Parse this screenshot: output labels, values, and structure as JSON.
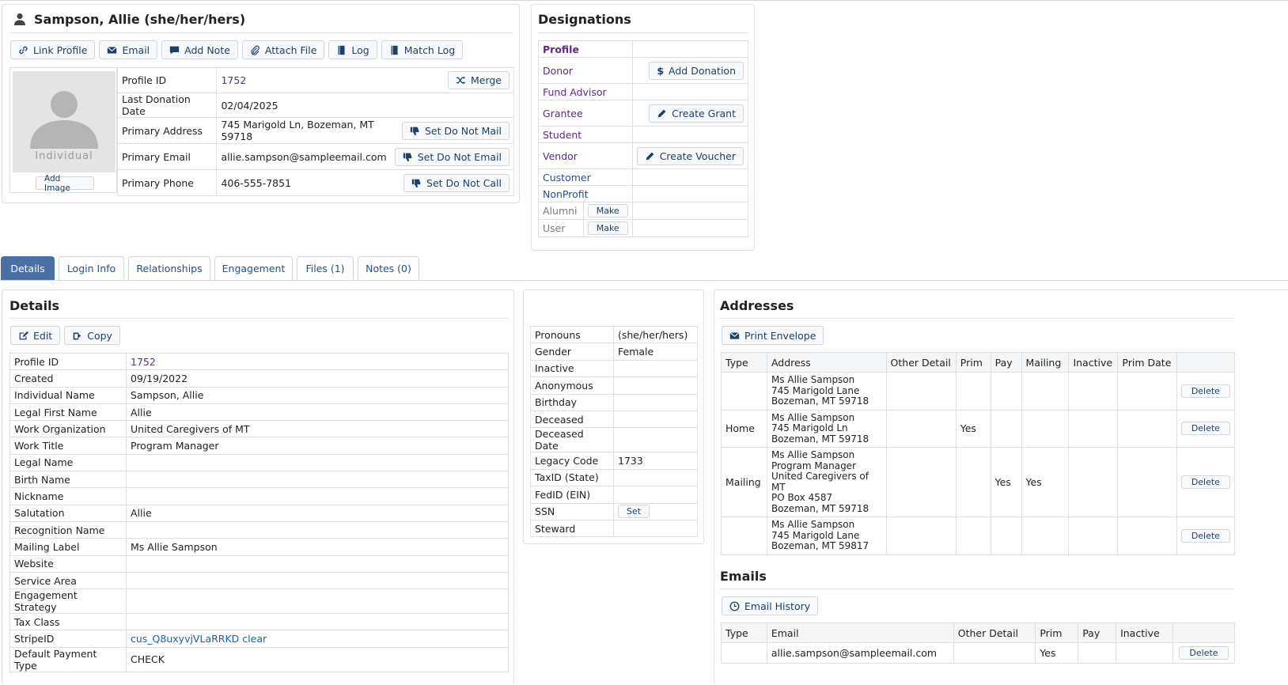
{
  "profile": {
    "title": "Sampson, Allie (she/her/hers)",
    "actions": {
      "link_profile": "Link Profile",
      "email": "Email",
      "add_note": "Add Note",
      "attach_file": "Attach File",
      "log": "Log",
      "match_log": "Match Log"
    },
    "photo_label": "Individual",
    "add_image": "Add Image",
    "fields": {
      "profile_id_label": "Profile ID",
      "profile_id": "1752",
      "merge": "Merge",
      "last_donation_label": "Last Donation Date",
      "last_donation": "02/04/2025",
      "address_label": "Primary Address",
      "address": "745 Marigold Ln, Bozeman, MT 59718",
      "do_not_mail": "Set Do Not Mail",
      "email_label": "Primary Email",
      "email": "allie.sampson@sampleemail.com",
      "do_not_email": "Set Do Not Email",
      "phone_label": "Primary Phone",
      "phone": "406-555-7851",
      "do_not_call": "Set Do Not Call"
    }
  },
  "designations": {
    "title": "Designations",
    "profile": "Profile",
    "donor": "Donor",
    "add_donation": "Add Donation",
    "fund_advisor": "Fund Advisor",
    "grantee": "Grantee",
    "create_grant": "Create Grant",
    "student": "Student",
    "vendor": "Vendor",
    "create_voucher": "Create Voucher",
    "customer": "Customer",
    "nonprofit": "NonProfit",
    "alumni": "Alumni",
    "user": "User",
    "make": "Make"
  },
  "tabs": [
    "Details",
    "Login Info",
    "Relationships",
    "Engagement",
    "Files (1)",
    "Notes (0)"
  ],
  "details": {
    "title": "Details",
    "edit": "Edit",
    "copy": "Copy",
    "rows": [
      {
        "label": "Profile ID",
        "value": "1752"
      },
      {
        "label": "Created",
        "value": "09/19/2022"
      },
      {
        "label": "Individual Name",
        "value": "Sampson, Allie"
      },
      {
        "label": "Legal First Name",
        "value": "Allie"
      },
      {
        "label": "Work Organization",
        "value": "United Caregivers of MT"
      },
      {
        "label": "Work Title",
        "value": "Program Manager"
      },
      {
        "label": "Legal Name",
        "value": ""
      },
      {
        "label": "Birth Name",
        "value": ""
      },
      {
        "label": "Nickname",
        "value": ""
      },
      {
        "label": "Salutation",
        "value": "Allie"
      },
      {
        "label": "Recognition Name",
        "value": ""
      },
      {
        "label": "Mailing Label",
        "value": "Ms Allie Sampson"
      },
      {
        "label": "Website",
        "value": ""
      },
      {
        "label": "Service Area",
        "value": ""
      },
      {
        "label": "Engagement Strategy",
        "value": ""
      },
      {
        "label": "Tax Class",
        "value": ""
      },
      {
        "label": "StripeID",
        "value": "cus_Q8uxyvjVLaRRKD clear"
      },
      {
        "label": "Default Payment Type",
        "value": "CHECK"
      }
    ]
  },
  "personal": {
    "rows": [
      {
        "label": "Pronouns",
        "value": "(she/her/hers)"
      },
      {
        "label": "Gender",
        "value": "Female"
      },
      {
        "label": "Inactive",
        "value": ""
      },
      {
        "label": "Anonymous",
        "value": ""
      },
      {
        "label": "Birthday",
        "value": ""
      },
      {
        "label": "Deceased",
        "value": ""
      },
      {
        "label": "Deceased Date",
        "value": ""
      },
      {
        "label": "Legacy Code",
        "value": "1733"
      },
      {
        "label": "TaxID (State)",
        "value": ""
      },
      {
        "label": "FedID (EIN)",
        "value": ""
      },
      {
        "label": "SSN",
        "value": ""
      },
      {
        "label": "Steward",
        "value": ""
      }
    ],
    "set": "Set"
  },
  "addresses": {
    "title": "Addresses",
    "print_envelope": "Print Envelope",
    "headers": [
      "Type",
      "Address",
      "Other Detail",
      "Prim",
      "Pay",
      "Mailing",
      "Inactive",
      "Prim Date",
      ""
    ],
    "rows": [
      {
        "type": "",
        "lines": [
          "Ms Allie Sampson",
          "745 Marigold Lane",
          "Bozeman, MT 59718"
        ],
        "prim": "",
        "pay": "",
        "mailing": ""
      },
      {
        "type": "Home",
        "lines": [
          "Ms Allie Sampson",
          "745 Marigold Ln",
          "Bozeman, MT 59718"
        ],
        "prim": "Yes",
        "pay": "",
        "mailing": ""
      },
      {
        "type": "Mailing",
        "lines": [
          "Ms Allie Sampson",
          "Program Manager",
          "United Caregivers of MT",
          "PO Box 4587",
          "Bozeman, MT 59718"
        ],
        "prim": "",
        "pay": "Yes",
        "mailing": "Yes"
      },
      {
        "type": "",
        "lines": [
          "Ms Allie Sampson",
          "745 Marigold Lane",
          "Bozeman, MT 59817"
        ],
        "prim": "",
        "pay": "",
        "mailing": ""
      }
    ],
    "delete": "Delete"
  },
  "emails": {
    "title": "Emails",
    "email_history": "Email History",
    "headers": [
      "Type",
      "Email",
      "Other Detail",
      "Prim",
      "Pay",
      "Inactive",
      ""
    ],
    "rows": [
      {
        "type": "",
        "email": "allie.sampson@sampleemail.com",
        "prim": "Yes"
      }
    ],
    "delete": "Delete"
  }
}
